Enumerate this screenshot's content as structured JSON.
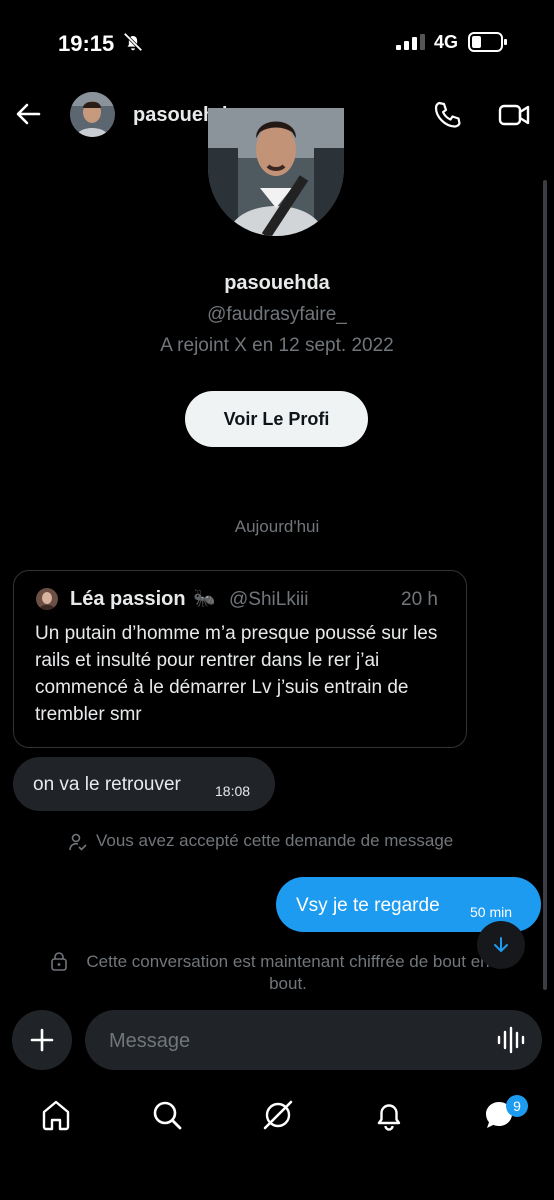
{
  "status_bar": {
    "time": "19:15",
    "network": "4G"
  },
  "header": {
    "name": "pasouehda"
  },
  "profile": {
    "name": "pasouehda",
    "handle": "@faudrasyfaire_",
    "joined": "A rejoint X en 12 sept. 2022",
    "view_profile_label": "Voir Le Profi"
  },
  "conversation": {
    "date_separator": "Aujourd'hui",
    "quoted_tweet": {
      "author": "Léa passion",
      "emoji": "🐜",
      "handle": "@ShiLkiii",
      "age": "20 h",
      "text": "Un putain d’homme m’a presque poussé sur les rails et insulté pour rentrer dans le rer j’ai commencé à le démarrer Lv j’suis entrain de trembler smr"
    },
    "incoming": {
      "text": "on va le retrouver",
      "time": "18:08"
    },
    "accepted_notice": "Vous avez accepté cette demande de message",
    "outgoing": {
      "text": "Vsy je te regarde",
      "time": "50 min"
    },
    "encryption_notice": "Cette conversation est maintenant chiffrée de bout en bout."
  },
  "composer": {
    "placeholder": "Message"
  },
  "nav": {
    "messages_badge": "9"
  },
  "colors": {
    "accent": "#1d9bf0",
    "background": "#000000",
    "bubble_in": "#202327",
    "muted": "#71767b"
  }
}
